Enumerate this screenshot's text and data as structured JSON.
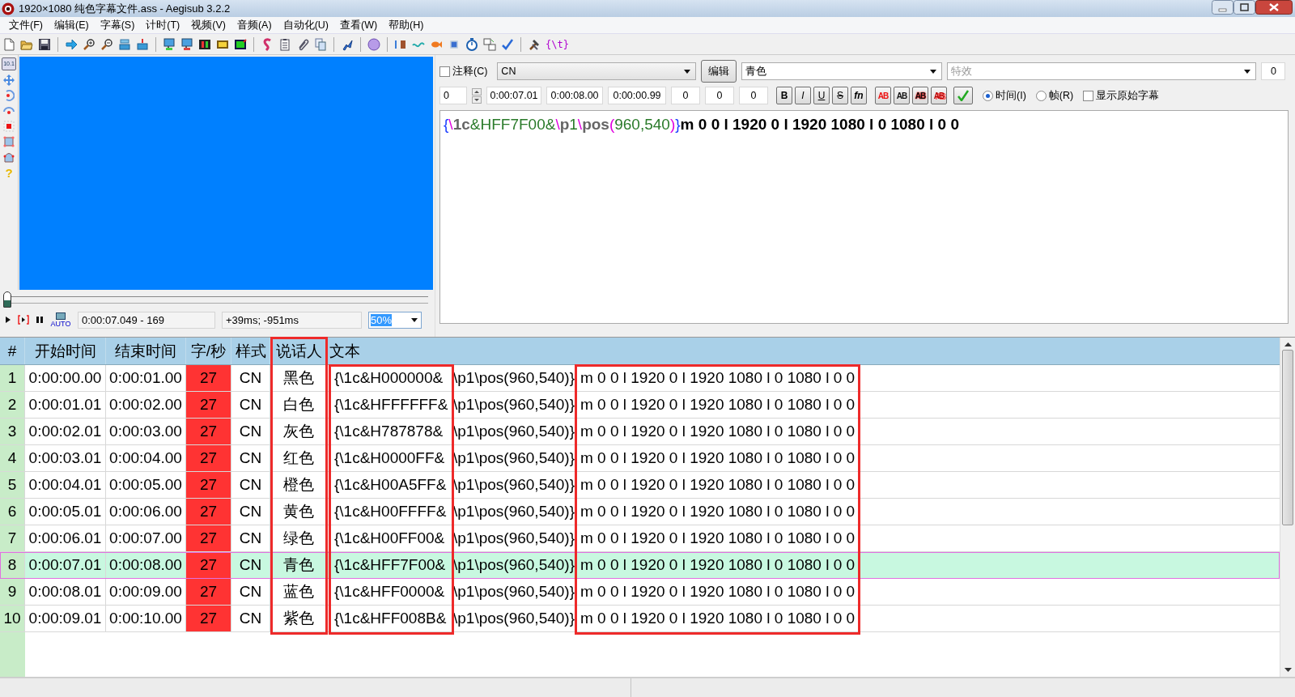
{
  "window": {
    "title": "1920×1080 纯色字幕文件.ass - Aegisub 3.2.2"
  },
  "menu": [
    "文件(F)",
    "编辑(E)",
    "字幕(S)",
    "计时(T)",
    "视频(V)",
    "音频(A)",
    "自动化(U)",
    "查看(W)",
    "帮助(H)"
  ],
  "toolbar": {
    "transform_label": "{\\t}"
  },
  "video": {
    "tool_label": "10.1",
    "help_glyph": "?",
    "seek": {
      "level": 0
    },
    "auto_label": "AUTO",
    "time_readout": "0:00:07.049 - 169",
    "offset_readout": "+39ms; -951ms",
    "zoom": "50%"
  },
  "editor": {
    "comment": {
      "label": "注释(C)",
      "checked": false
    },
    "style": "CN",
    "edit_button": "编辑",
    "actor": "青色",
    "effect_placeholder": "特效",
    "counter": "0",
    "layer": "0",
    "start": "0:00:07.01",
    "end": "0:00:08.00",
    "duration": "0:00:00.99",
    "margins": [
      "0",
      "0",
      "0"
    ],
    "format_buttons": [
      {
        "label": "B",
        "kind": "bold"
      },
      {
        "label": "I",
        "kind": "italic"
      },
      {
        "label": "U",
        "kind": "underline"
      },
      {
        "label": "S",
        "kind": "strike"
      },
      {
        "label": "fn",
        "kind": "font"
      }
    ],
    "color_buttons": [
      {
        "label": "AB",
        "kind": "primary"
      },
      {
        "label": "AB",
        "kind": "secondary"
      },
      {
        "label": "AB",
        "kind": "outline"
      },
      {
        "label": "AB",
        "kind": "shadow"
      }
    ],
    "time_mode": [
      {
        "label": "时间(I)",
        "selected": true
      },
      {
        "label": "帧(R)",
        "selected": false
      }
    ],
    "show_original": {
      "label": "显示原始字幕",
      "checked": false
    },
    "text_tokens": [
      {
        "kind": "brace",
        "text": "{"
      },
      {
        "kind": "slash",
        "text": "\\"
      },
      {
        "kind": "tag",
        "text": "1c"
      },
      {
        "kind": "value",
        "text": "&HFF7F00&"
      },
      {
        "kind": "slash",
        "text": "\\"
      },
      {
        "kind": "tag",
        "text": "p"
      },
      {
        "kind": "value",
        "text": "1"
      },
      {
        "kind": "slash",
        "text": "\\"
      },
      {
        "kind": "tag",
        "text": "pos"
      },
      {
        "kind": "paren",
        "text": "("
      },
      {
        "kind": "value",
        "text": "960,540"
      },
      {
        "kind": "paren",
        "text": ")"
      },
      {
        "kind": "brace",
        "text": "}"
      },
      {
        "kind": "drawing",
        "text": "m 0 0 l 1920 0 l 1920 1080 l 0 1080 l 0 0"
      }
    ]
  },
  "grid": {
    "columns": [
      "#",
      "开始时间",
      "结束时间",
      "字/秒",
      "样式",
      "说话人",
      "文本"
    ],
    "rows": [
      {
        "number": "1",
        "start": "0:00:00.00",
        "end": "0:00:01.00",
        "cps": "27",
        "style": "CN",
        "actor": "黑色",
        "text_parts": [
          "{\\1c&H000000&",
          "\\p1\\pos(960,540)}",
          "m 0 0 l 1920 0 l 1920 1080 l 0 1080 l 0 0"
        ],
        "selected": false
      },
      {
        "number": "2",
        "start": "0:00:01.01",
        "end": "0:00:02.00",
        "cps": "27",
        "style": "CN",
        "actor": "白色",
        "text_parts": [
          "{\\1c&HFFFFFF&",
          "\\p1\\pos(960,540)}",
          "m 0 0 l 1920 0 l 1920 1080 l 0 1080 l 0 0"
        ],
        "selected": false
      },
      {
        "number": "3",
        "start": "0:00:02.01",
        "end": "0:00:03.00",
        "cps": "27",
        "style": "CN",
        "actor": "灰色",
        "text_parts": [
          "{\\1c&H787878&",
          "\\p1\\pos(960,540)}",
          "m 0 0 l 1920 0 l 1920 1080 l 0 1080 l 0 0"
        ],
        "selected": false
      },
      {
        "number": "4",
        "start": "0:00:03.01",
        "end": "0:00:04.00",
        "cps": "27",
        "style": "CN",
        "actor": "红色",
        "text_parts": [
          "{\\1c&H0000FF&",
          "\\p1\\pos(960,540)}",
          "m 0 0 l 1920 0 l 1920 1080 l 0 1080 l 0 0"
        ],
        "selected": false
      },
      {
        "number": "5",
        "start": "0:00:04.01",
        "end": "0:00:05.00",
        "cps": "27",
        "style": "CN",
        "actor": "橙色",
        "text_parts": [
          "{\\1c&H00A5FF&",
          "\\p1\\pos(960,540)}",
          "m 0 0 l 1920 0 l 1920 1080 l 0 1080 l 0 0"
        ],
        "selected": false
      },
      {
        "number": "6",
        "start": "0:00:05.01",
        "end": "0:00:06.00",
        "cps": "27",
        "style": "CN",
        "actor": "黄色",
        "text_parts": [
          "{\\1c&H00FFFF&",
          "\\p1\\pos(960,540)}",
          "m 0 0 l 1920 0 l 1920 1080 l 0 1080 l 0 0"
        ],
        "selected": false
      },
      {
        "number": "7",
        "start": "0:00:06.01",
        "end": "0:00:07.00",
        "cps": "27",
        "style": "CN",
        "actor": "绿色",
        "text_parts": [
          "{\\1c&H00FF00&",
          "\\p1\\pos(960,540)}",
          "m 0 0 l 1920 0 l 1920 1080 l 0 1080 l 0 0"
        ],
        "selected": false
      },
      {
        "number": "8",
        "start": "0:00:07.01",
        "end": "0:00:08.00",
        "cps": "27",
        "style": "CN",
        "actor": "青色",
        "text_parts": [
          "{\\1c&HFF7F00&",
          "\\p1\\pos(960,540)}",
          "m 0 0 l 1920 0 l 1920 1080 l 0 1080 l 0 0"
        ],
        "selected": true
      },
      {
        "number": "9",
        "start": "0:00:08.01",
        "end": "0:00:09.00",
        "cps": "27",
        "style": "CN",
        "actor": "蓝色",
        "text_parts": [
          "{\\1c&HFF0000&",
          "\\p1\\pos(960,540)}",
          "m 0 0 l 1920 0 l 1920 1080 l 0 1080 l 0 0"
        ],
        "selected": false
      },
      {
        "number": "10",
        "start": "0:00:09.01",
        "end": "0:00:10.00",
        "cps": "27",
        "style": "CN",
        "actor": "紫色",
        "text_parts": [
          "{\\1c&HFF008B&",
          "\\p1\\pos(960,540)}",
          "m 0 0 l 1920 0 l 1920 1080 l 0 1080 l 0 0"
        ],
        "selected": false
      }
    ]
  },
  "highlight_boxes": [
    {
      "kind": "actor-column"
    },
    {
      "kind": "text-tag"
    },
    {
      "kind": "text-drawing"
    }
  ]
}
